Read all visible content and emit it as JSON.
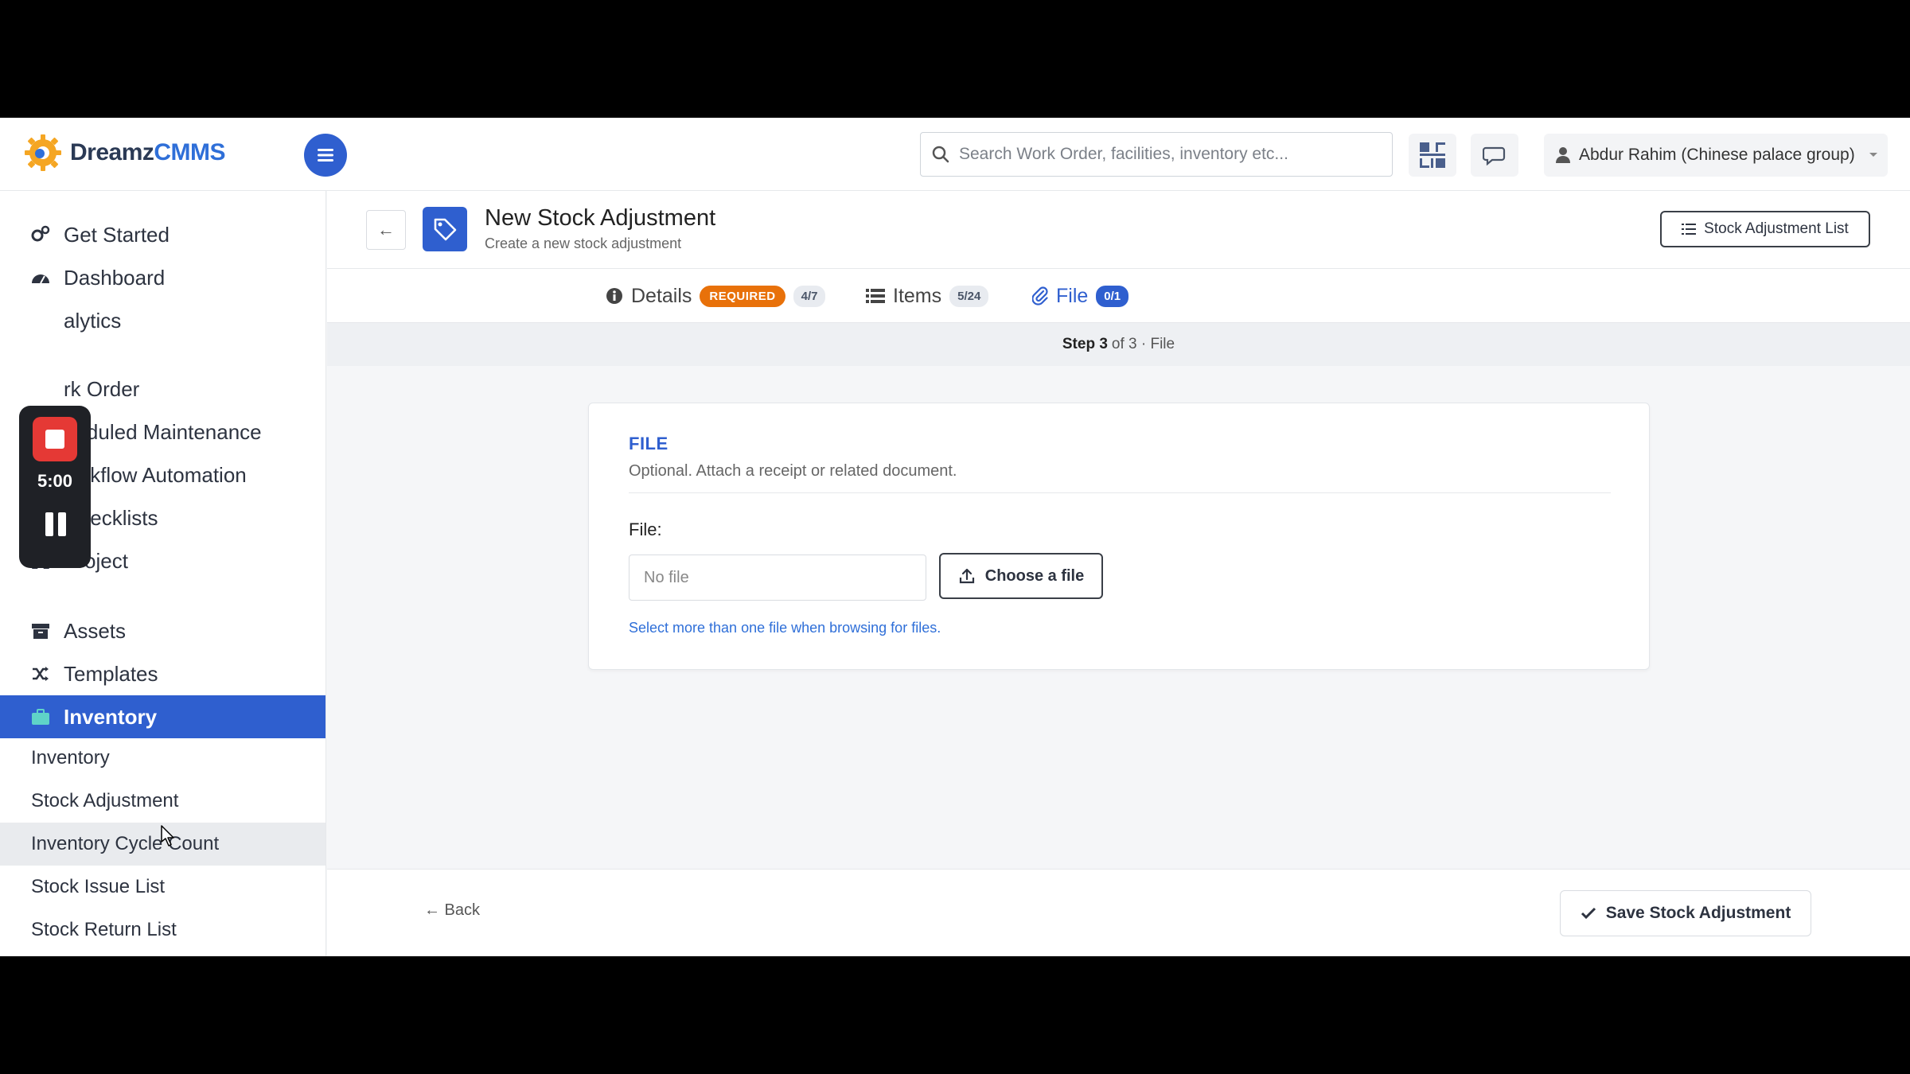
{
  "app": {
    "logo_text_main": "Dreamz",
    "logo_text_accent": "CMMS"
  },
  "header": {
    "search_placeholder": "Search Work Order, facilities, inventory etc...",
    "user_name": "Abdur Rahim (Chinese palace group)"
  },
  "sidebar": {
    "items": [
      {
        "label": "Get Started",
        "icon": "cogs-icon"
      },
      {
        "label": "Dashboard",
        "icon": "dashboard-icon"
      },
      {
        "label": "alytics",
        "icon": "analytics-icon"
      },
      {
        "label": "rk Order",
        "icon": "work-order-icon"
      },
      {
        "label": "heduled Maintenance",
        "icon": "calendar-icon"
      },
      {
        "label": "Workflow Automation",
        "icon": "flow-icon"
      },
      {
        "label": "Checklists",
        "icon": "checkbox-icon"
      },
      {
        "label": "Project",
        "icon": "project-icon"
      },
      {
        "label": "Assets",
        "icon": "archive-icon"
      },
      {
        "label": "Templates",
        "icon": "shuffle-icon"
      },
      {
        "label": "Inventory",
        "icon": "briefcase-icon",
        "active": true
      }
    ],
    "sub_items": [
      {
        "label": "Inventory"
      },
      {
        "label": "Stock Adjustment"
      },
      {
        "label": "Inventory Cycle Count",
        "hover": true
      },
      {
        "label": "Stock Issue List"
      },
      {
        "label": "Stock Return List"
      }
    ]
  },
  "recorder": {
    "time": "5:00"
  },
  "page": {
    "title": "New Stock Adjustment",
    "subtitle": "Create a new stock adjustment",
    "list_button": "Stock Adjustment List"
  },
  "tabs": [
    {
      "label": "Details",
      "badge_required": "REQUIRED",
      "count": "4/7"
    },
    {
      "label": "Items",
      "count": "5/24"
    },
    {
      "label": "File",
      "count": "0/1",
      "active": true
    }
  ],
  "step": {
    "prefix": "Step 3",
    "suffix": "of 3 · File"
  },
  "file_card": {
    "title": "FILE",
    "description": "Optional. Attach a receipt or related document.",
    "field_label": "File:",
    "file_value": "No file",
    "choose_label": "Choose a file",
    "hint": "Select more than one file when browsing for files."
  },
  "footer": {
    "back_label": "← Back",
    "save_label": "Save Stock Adjustment"
  },
  "colors": {
    "brand": "#2f5fcf",
    "required_badge": "#e8710a",
    "recorder_stop": "#e53935"
  }
}
